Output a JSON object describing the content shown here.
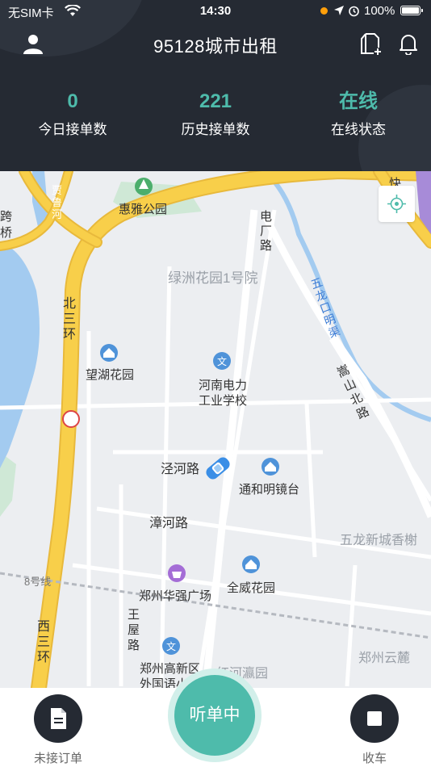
{
  "status_bar": {
    "carrier": "无SIM卡",
    "time": "14:30",
    "battery": "100%"
  },
  "nav": {
    "title": "95128城市出租",
    "icons": [
      "user-icon",
      "add-document-icon",
      "bell-icon"
    ]
  },
  "stats": [
    {
      "value": "0",
      "label": "今日接单数"
    },
    {
      "value": "221",
      "label": "历史接单数"
    },
    {
      "value": "在线",
      "label": "在线状态"
    }
  ],
  "map": {
    "labels": {
      "huiya": "惠雅公园",
      "lvzhou": "绿洲花园1号院",
      "beisanhuan": "北三环",
      "wanghu": "望湖花园",
      "school1": "河南电力",
      "school2": "工业学校",
      "jinghe": "泾河路",
      "tonghe": "通和明镜台",
      "zhanghe": "漳河路",
      "wulong": "五龙新城香榭",
      "line8": "8号线",
      "huaqiang": "郑州华强广场",
      "quanwei": "全威花园",
      "xisanhuan": "西三环",
      "wangwu": "王屋路",
      "gaoxin1": "郑州高新区",
      "gaoxin2": "外国语小",
      "hongheying": "红河瀛园",
      "zhenggui": "郑州云麓",
      "diangchang": "电厂路",
      "wulongkou": "五龙口明渠",
      "songshan": "嵩山北路",
      "jialu": "贾鲁河",
      "kua": "跨",
      "qiao": "桥",
      "kuai": "快"
    },
    "accent_color": "#4ebbab",
    "road_color": "#f8cf4a"
  },
  "bottom_bar": {
    "left_label": "未接订单",
    "center_label": "听单中",
    "right_label": "收车"
  },
  "colors": {
    "header_bg": "#252a33",
    "accent": "#4ebbab"
  }
}
